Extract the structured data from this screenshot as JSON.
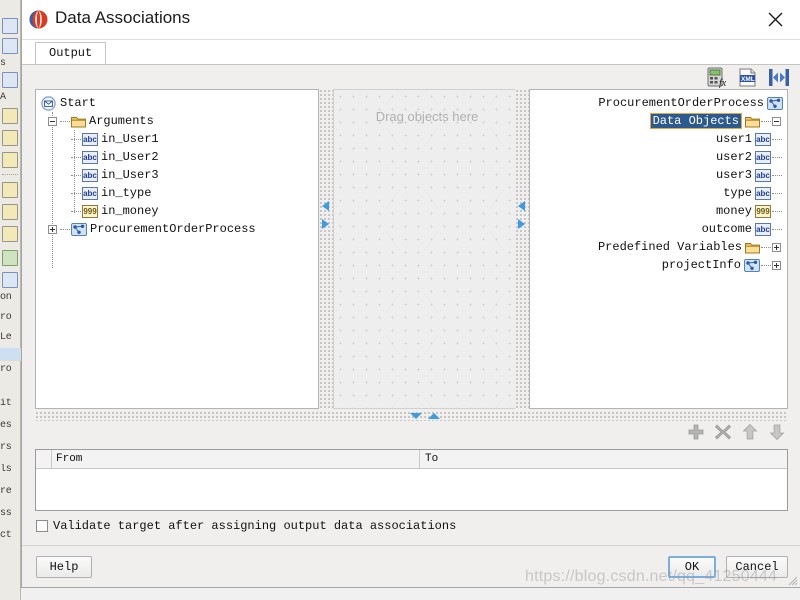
{
  "window": {
    "title": "Data Associations",
    "app_icon": "app-logo-icon",
    "close_icon": "close-icon"
  },
  "tabs": [
    {
      "label": "Output",
      "active": true
    }
  ],
  "toolbar": {
    "buttons": [
      {
        "name": "expression-editor-icon",
        "label": "fx"
      },
      {
        "name": "xml-transformation-icon",
        "label": "XML"
      },
      {
        "name": "auto-map-icon",
        "label": "Map"
      }
    ]
  },
  "source_tree": {
    "title": "Source Tree",
    "nodes": [
      {
        "label": "Start",
        "icon": "start-event-icon",
        "indent": 0,
        "expander": "none"
      },
      {
        "label": "Arguments",
        "icon": "folder-icon",
        "indent": 1,
        "expander": "minus"
      },
      {
        "label": "in_User1",
        "icon": "string-abc-icon",
        "indent": 2,
        "expander": "none"
      },
      {
        "label": "in_User2",
        "icon": "string-abc-icon",
        "indent": 2,
        "expander": "none"
      },
      {
        "label": "in_User3",
        "icon": "string-abc-icon",
        "indent": 2,
        "expander": "none"
      },
      {
        "label": "in_type",
        "icon": "string-abc-icon",
        "indent": 2,
        "expander": "none"
      },
      {
        "label": "in_money",
        "icon": "number-999-icon",
        "indent": 2,
        "expander": "none"
      },
      {
        "label": "ProcurementOrderProcess",
        "icon": "process-icon",
        "indent": 1,
        "expander": "plus"
      }
    ]
  },
  "canvas": {
    "placeholder": "Drag objects here"
  },
  "target_tree": {
    "title": "Target Tree",
    "nodes": [
      {
        "label": "ProcurementOrderProcess",
        "icon": "process-icon",
        "expander": "none",
        "selected": false
      },
      {
        "label": "Data Objects",
        "icon": "folder-icon",
        "expander": "minus",
        "selected": true
      },
      {
        "label": "user1",
        "icon": "string-abc-icon",
        "expander": "none",
        "selected": false
      },
      {
        "label": "user2",
        "icon": "string-abc-icon",
        "expander": "none",
        "selected": false
      },
      {
        "label": "user3",
        "icon": "string-abc-icon",
        "expander": "none",
        "selected": false
      },
      {
        "label": "type",
        "icon": "string-abc-icon",
        "expander": "none",
        "selected": false
      },
      {
        "label": "money",
        "icon": "number-999-icon",
        "expander": "none",
        "selected": false
      },
      {
        "label": "outcome",
        "icon": "string-abc-icon",
        "expander": "none",
        "selected": false
      },
      {
        "label": "Predefined Variables",
        "icon": "folder-icon",
        "expander": "plus",
        "selected": false
      },
      {
        "label": "projectInfo",
        "icon": "process-icon",
        "expander": "plus",
        "selected": false
      }
    ]
  },
  "row_actions": [
    {
      "name": "add-association-icon",
      "label": "Add"
    },
    {
      "name": "delete-association-icon",
      "label": "Delete"
    },
    {
      "name": "move-up-icon",
      "label": "Move Up"
    },
    {
      "name": "move-down-icon",
      "label": "Move Down"
    }
  ],
  "associations_table": {
    "columns": [
      "",
      "From",
      "To"
    ],
    "rows": []
  },
  "validate": {
    "label": "Validate target after assigning output data associations",
    "checked": false
  },
  "buttons": {
    "help": "Help",
    "ok": "OK",
    "cancel": "Cancel"
  },
  "watermark": "https://blog.csdn.net/qq_41250444",
  "background_app": {
    "fragments": [
      "...",
      "s",
      "A",
      "on",
      "ro",
      "Le",
      "ro",
      "it",
      "es",
      "rs",
      "ls",
      "re",
      "ss",
      "ct"
    ]
  },
  "colors": {
    "selection_bg": "#2d5a8e",
    "selection_border": "#e8a33d",
    "splitter_arrow": "#3d9ce0",
    "accent_focus": "#7ab0e0",
    "dialog_bg": "#f0efed"
  }
}
